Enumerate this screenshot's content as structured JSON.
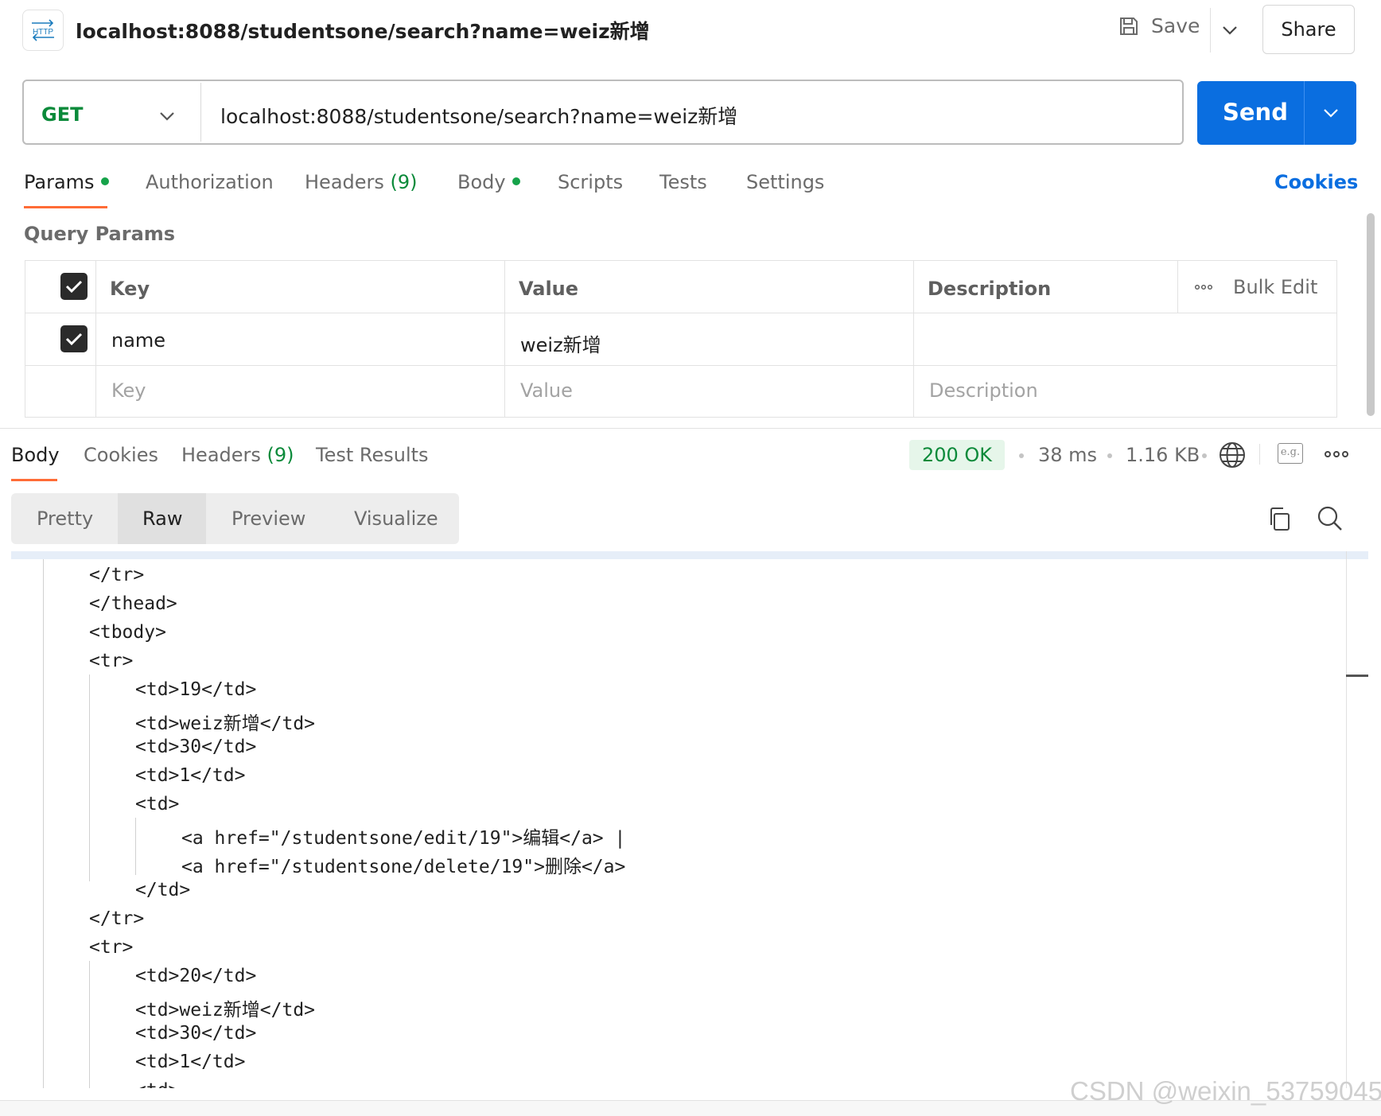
{
  "header": {
    "icon_text": "HTTP",
    "title": "localhost:8088/studentsone/search?name=weiz新增",
    "save_label": "Save",
    "share_label": "Share"
  },
  "request": {
    "method": "GET",
    "url": "localhost:8088/studentsone/search?name=weiz新增",
    "send_label": "Send"
  },
  "req_tabs": [
    {
      "label": "Params",
      "dot": true
    },
    {
      "label": "Authorization"
    },
    {
      "label": "Headers",
      "count": "(9)"
    },
    {
      "label": "Body",
      "dot": true
    },
    {
      "label": "Scripts"
    },
    {
      "label": "Tests"
    },
    {
      "label": "Settings"
    }
  ],
  "cookies_label": "Cookies",
  "query_params": {
    "title": "Query Params",
    "headers": {
      "key": "Key",
      "value": "Value",
      "description": "Description"
    },
    "bulk_edit": "Bulk Edit",
    "rows": [
      {
        "checked": true,
        "key": "name",
        "value": "weiz新增",
        "description": ""
      }
    ],
    "placeholders": {
      "key": "Key",
      "value": "Value",
      "description": "Description"
    }
  },
  "response": {
    "tabs": [
      {
        "label": "Body"
      },
      {
        "label": "Cookies"
      },
      {
        "label": "Headers",
        "count": "(9)"
      },
      {
        "label": "Test Results"
      }
    ],
    "status": "200 OK",
    "time": "38 ms",
    "size": "1.16 KB",
    "example_label": "e.g.",
    "view_modes": [
      "Pretty",
      "Raw",
      "Preview",
      "Visualize"
    ],
    "active_view": "Raw",
    "code_lines": [
      "</tr>",
      "</thead>",
      "<tbody>",
      "<tr>",
      "<td>19</td>",
      "<td>weiz新增</td>",
      "<td>30</td>",
      "<td>1</td>",
      "<td>",
      "<a href=\"/studentsone/edit/19\">编辑</a> |",
      "<a href=\"/studentsone/delete/19\">删除</a>",
      "</td>",
      "</tr>",
      "<tr>",
      "<td>20</td>",
      "<td>weiz新增</td>",
      "<td>30</td>",
      "<td>1</td>",
      "<td>"
    ]
  },
  "watermark": "CSDN @weixin_53759045",
  "colors": {
    "accent": "#0a6ee0",
    "tab_underline": "#ff6c37",
    "method_get": "#0b8a3a",
    "status_ok_bg": "#e6f6ea"
  }
}
